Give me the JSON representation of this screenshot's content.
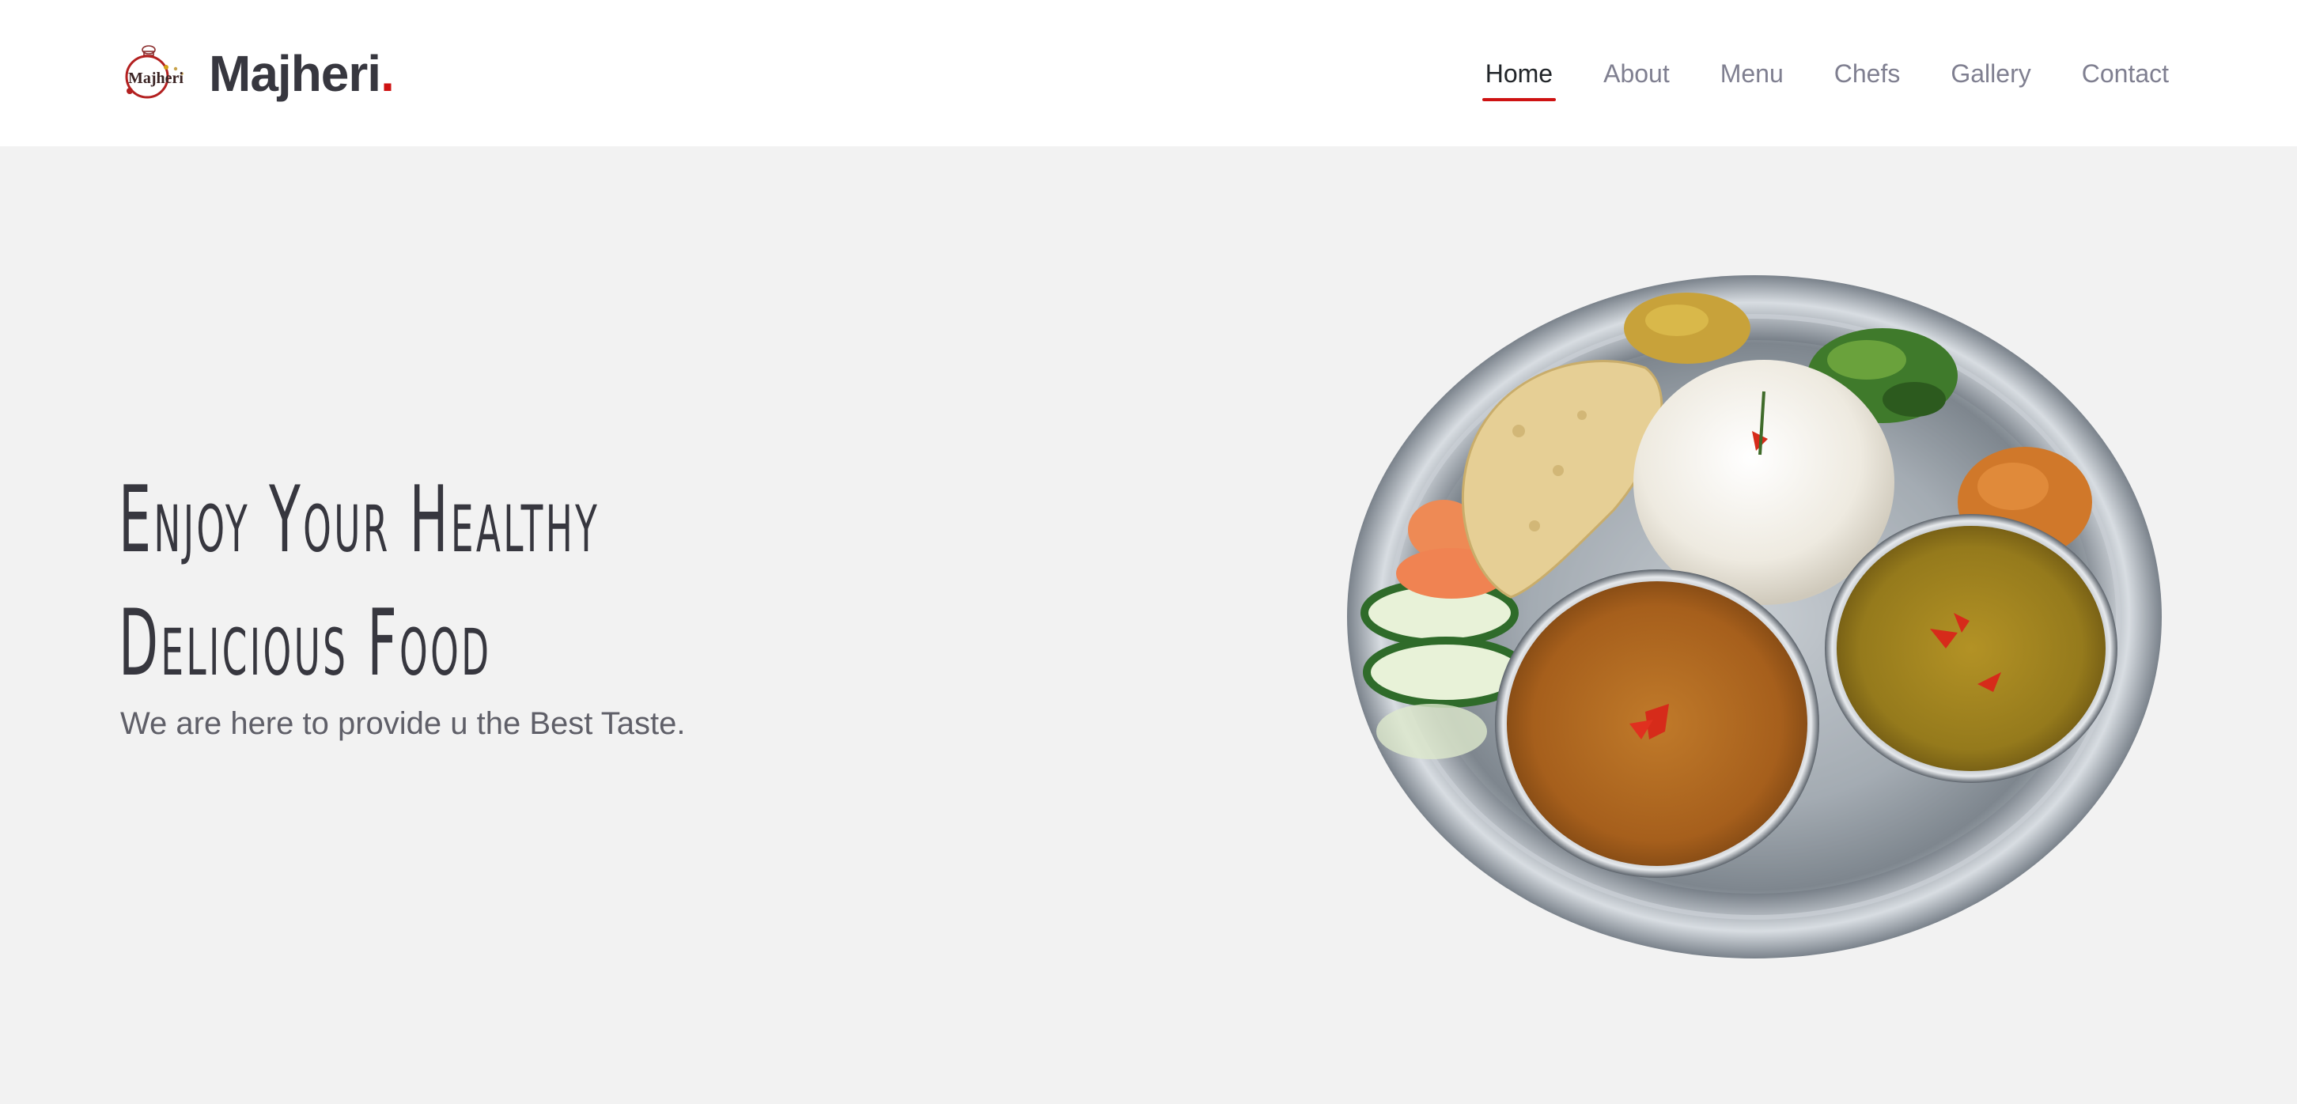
{
  "brand": {
    "name": "Majheri",
    "dot": ".",
    "logo_text": "Majheri",
    "logo_icon": "chef-hat-logo-icon"
  },
  "nav": {
    "items": [
      {
        "label": "Home",
        "active": true
      },
      {
        "label": "About",
        "active": false
      },
      {
        "label": "Menu",
        "active": false
      },
      {
        "label": "Chefs",
        "active": false
      },
      {
        "label": "Gallery",
        "active": false
      },
      {
        "label": "Contact",
        "active": false
      }
    ]
  },
  "hero": {
    "title_line1": "Enjoy Your Healthy",
    "title_line2": "Delicious Food",
    "subtitle": "We are here to provide u the Best Taste.",
    "image": "thali-plate-image"
  },
  "colors": {
    "accent": "#ce1212",
    "text_dark": "#37373f",
    "nav_text": "#7f7f90",
    "hero_bg": "#f2f2f2",
    "header_bg": "#ffffff"
  }
}
